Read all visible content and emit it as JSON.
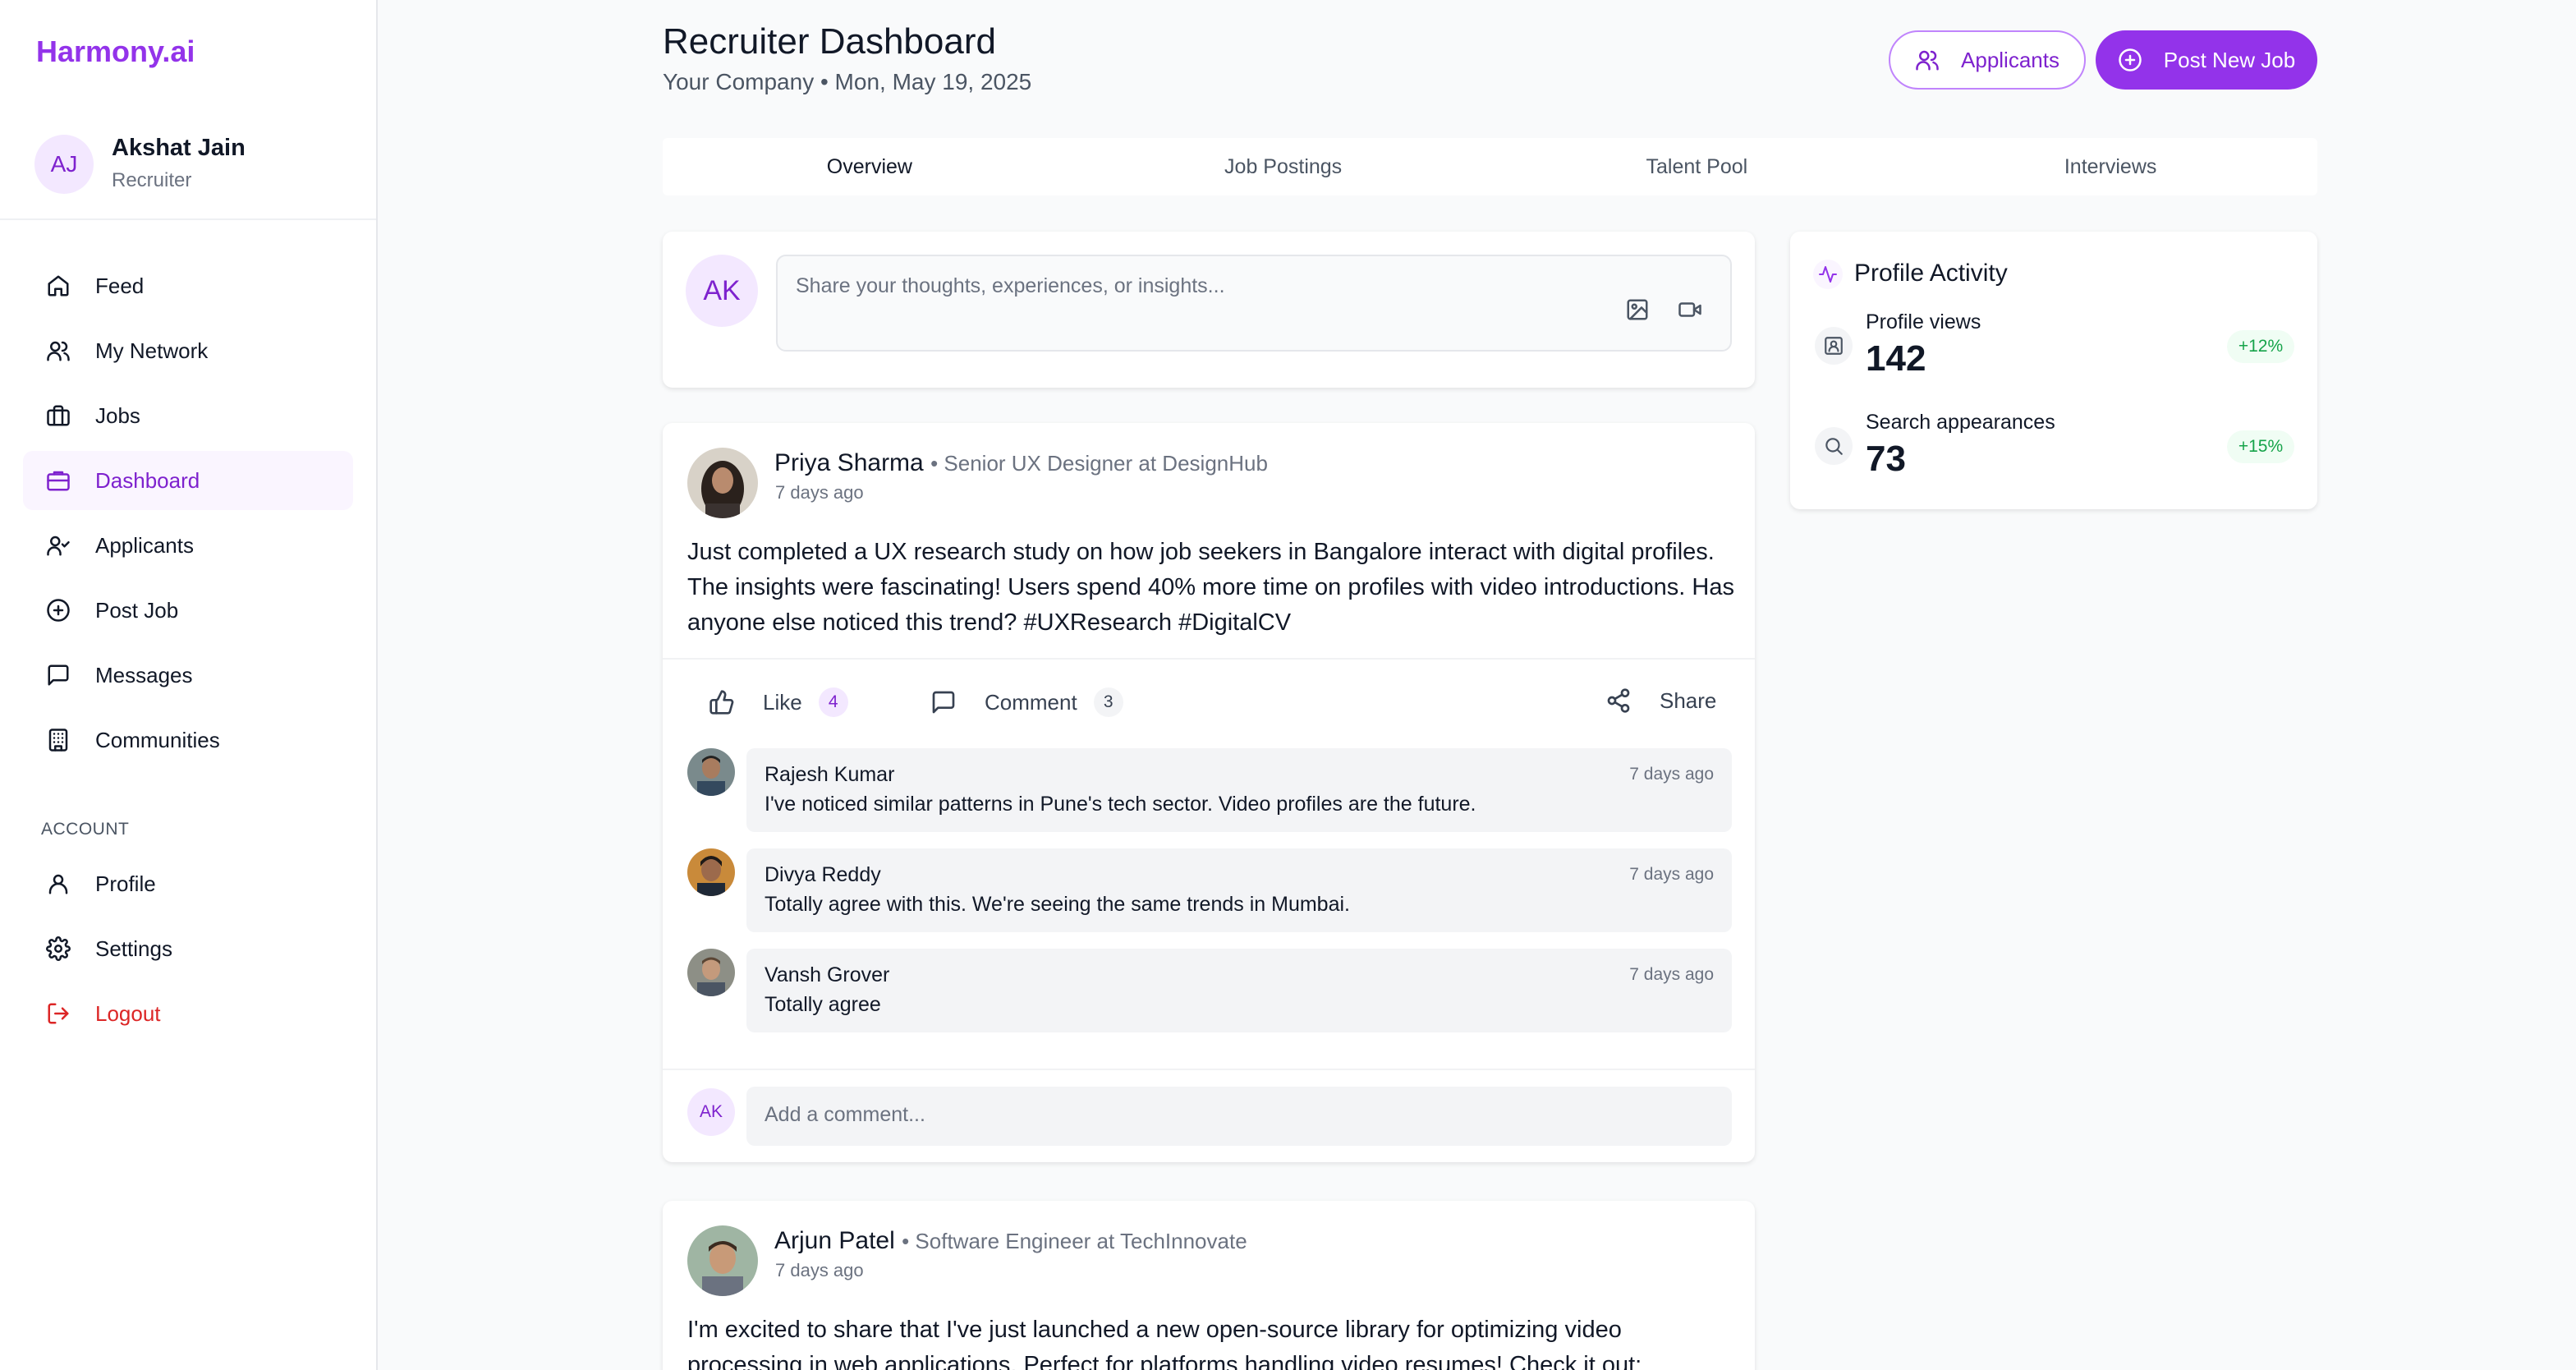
{
  "brand": "Harmony.ai",
  "user": {
    "initials": "AJ",
    "name": "Akshat Jain",
    "role": "Recruiter"
  },
  "nav": {
    "items": [
      {
        "label": "Feed",
        "icon": "home-icon"
      },
      {
        "label": "My Network",
        "icon": "users-icon"
      },
      {
        "label": "Jobs",
        "icon": "briefcase-icon"
      },
      {
        "label": "Dashboard",
        "icon": "dashboard-icon",
        "active": true
      },
      {
        "label": "Applicants",
        "icon": "user-check-icon"
      },
      {
        "label": "Post Job",
        "icon": "plus-circle-icon"
      },
      {
        "label": "Messages",
        "icon": "message-icon"
      },
      {
        "label": "Communities",
        "icon": "building-icon"
      }
    ],
    "account_heading": "ACCOUNT",
    "account_items": [
      {
        "label": "Profile",
        "icon": "user-icon"
      },
      {
        "label": "Settings",
        "icon": "gear-icon"
      },
      {
        "label": "Logout",
        "icon": "logout-icon"
      }
    ]
  },
  "header": {
    "title": "Recruiter Dashboard",
    "subtitle": "Your Company • Mon, May 19, 2025",
    "applicants_button": "Applicants",
    "post_job_button": "Post New Job"
  },
  "tabs": [
    "Overview",
    "Job Postings",
    "Talent Pool",
    "Interviews"
  ],
  "composer": {
    "initials": "AK",
    "placeholder": "Share your thoughts, experiences, or insights..."
  },
  "posts": [
    {
      "author": "Priya Sharma",
      "headline": "• Senior UX Designer at DesignHub",
      "time": "7 days ago",
      "body": "Just completed a UX research study on how job seekers in Bangalore interact with digital profiles. The insights were fascinating! Users spend 40% more time on profiles with video introductions. Has anyone else noticed this trend? #UXResearch #DigitalCV",
      "like_label": "Like",
      "like_count": "4",
      "comment_label": "Comment",
      "comment_count": "3",
      "share_label": "Share",
      "comments": [
        {
          "name": "Rajesh Kumar",
          "text": "I've noticed similar patterns in Pune's tech sector. Video profiles are the future.",
          "time": "7 days ago"
        },
        {
          "name": "Divya Reddy",
          "text": "Totally agree with this. We're seeing the same trends in Mumbai.",
          "time": "7 days ago"
        },
        {
          "name": "Vansh Grover",
          "text": "Totally agree",
          "time": "7 days ago"
        }
      ],
      "add_comment_initials": "AK",
      "add_comment_placeholder": "Add a comment..."
    },
    {
      "author": "Arjun Patel",
      "headline": "• Software Engineer at TechInnovate",
      "time": "7 days ago",
      "body": "I'm excited to share that I've just launched a new open-source library for optimizing video processing in web applications. Perfect for platforms handling video resumes! Check it out:"
    }
  ],
  "activity": {
    "title": "Profile Activity",
    "stats": [
      {
        "label": "Profile views",
        "value": "142",
        "delta": "+12%"
      },
      {
        "label": "Search appearances",
        "value": "73",
        "delta": "+15%"
      }
    ]
  },
  "colors": {
    "accent": "#9333ea",
    "accent_light": "#f3e8ff",
    "danger": "#dc2626",
    "success": "#16a34a"
  }
}
